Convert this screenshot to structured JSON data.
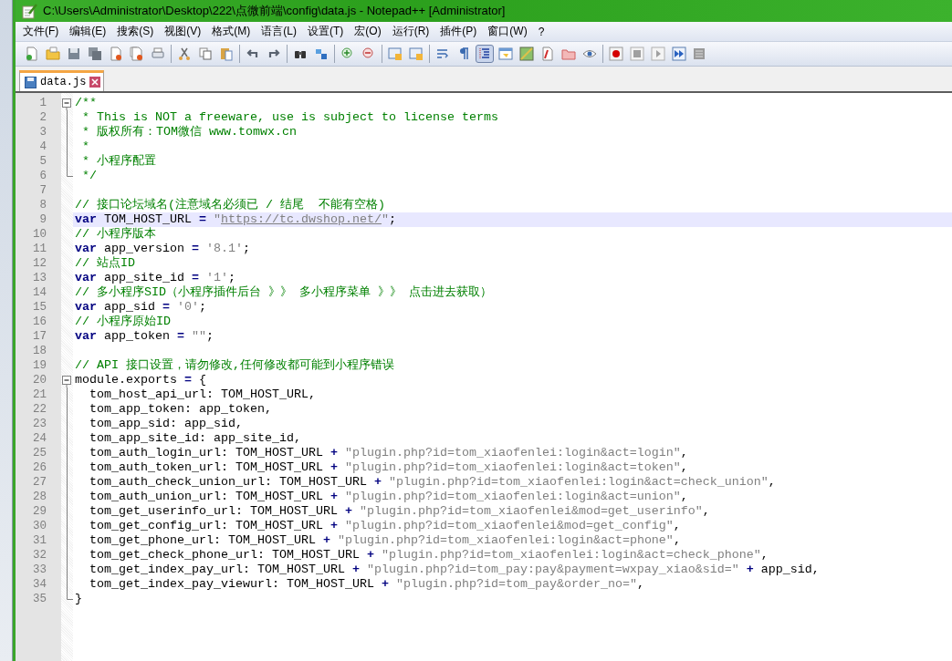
{
  "window": {
    "title": "C:\\Users\\Administrator\\Desktop\\222\\点微前端\\config\\data.js - Notepad++ [Administrator]"
  },
  "menu": [
    "文件(F)",
    "编辑(E)",
    "搜索(S)",
    "视图(V)",
    "格式(M)",
    "语言(L)",
    "设置(T)",
    "宏(O)",
    "运行(R)",
    "插件(P)",
    "窗口(W)",
    "?"
  ],
  "toolbar": [
    [
      {
        "pressed": false
      },
      {
        "pressed": false
      },
      {
        "pressed": false
      },
      {
        "pressed": false
      },
      {
        "pressed": false
      },
      {
        "pressed": false
      },
      {
        "pressed": false
      }
    ],
    [
      {
        "pressed": false
      },
      {
        "pressed": false
      },
      {
        "pressed": false
      }
    ],
    [
      {
        "pressed": false
      },
      {
        "pressed": false
      }
    ],
    [
      {
        "pressed": false
      },
      {
        "pressed": false
      }
    ],
    [
      {
        "pressed": false
      },
      {
        "pressed": false
      }
    ],
    [
      {
        "pressed": false
      },
      {
        "pressed": false
      }
    ],
    [
      {
        "pressed": false
      },
      {
        "pressed": false
      },
      {
        "pressed": true
      },
      {
        "pressed": false
      },
      {
        "pressed": false
      },
      {
        "pressed": false
      },
      {
        "pressed": false
      },
      {
        "pressed": false
      }
    ],
    [
      {
        "pressed": false
      },
      {
        "pressed": false
      },
      {
        "pressed": false
      },
      {
        "pressed": false
      },
      {
        "pressed": false
      }
    ]
  ],
  "tabs": [
    {
      "label": "data.js",
      "selected": true
    }
  ],
  "editor": {
    "lines": [
      {
        "n": "1",
        "kind": "foldstart",
        "selected": false,
        "tokens": [
          {
            "kind": "comment",
            "text": "/**"
          }
        ]
      },
      {
        "n": "2",
        "kind": "foldbody",
        "selected": false,
        "tokens": [
          {
            "kind": "comment",
            "text": " * This is NOT a freeware, use is subject to license terms"
          }
        ]
      },
      {
        "n": "3",
        "kind": "foldbody",
        "selected": false,
        "tokens": [
          {
            "kind": "comment",
            "text": " * 版权所有：TOM微信 www.tomwx.cn"
          }
        ]
      },
      {
        "n": "4",
        "kind": "foldbody",
        "selected": false,
        "tokens": [
          {
            "kind": "comment",
            "text": " *"
          }
        ]
      },
      {
        "n": "5",
        "kind": "foldbody",
        "selected": false,
        "tokens": [
          {
            "kind": "comment",
            "text": " * 小程序配置"
          }
        ]
      },
      {
        "n": "6",
        "kind": "foldend",
        "selected": false,
        "tokens": [
          {
            "kind": "comment",
            "text": " */"
          }
        ]
      },
      {
        "n": "7",
        "kind": "plain",
        "selected": false
      },
      {
        "n": "8",
        "kind": "plain",
        "selected": false,
        "tokens": [
          {
            "kind": "comment",
            "text": "// 接口论坛域名(注意域名必须已 / 结尾  不能有空格)"
          }
        ]
      },
      {
        "n": "9",
        "kind": "plain",
        "selected": true,
        "tokens": [
          {
            "kind": "keyword",
            "text": "var"
          },
          {
            "kind": "text",
            "text": " TOM_HOST_URL "
          },
          {
            "kind": "operator",
            "text": "="
          },
          {
            "kind": "string",
            "text": " \""
          },
          {
            "kind": "url",
            "text": "https://tc.dwshop.net/"
          },
          {
            "kind": "string",
            "text": "\""
          },
          {
            "kind": "text",
            "text": ";"
          }
        ]
      },
      {
        "n": "10",
        "kind": "plain",
        "selected": false,
        "tokens": [
          {
            "kind": "comment",
            "text": "// 小程序版本"
          }
        ]
      },
      {
        "n": "11",
        "kind": "plain",
        "selected": false,
        "tokens": [
          {
            "kind": "keyword",
            "text": "var"
          },
          {
            "kind": "text",
            "text": " app_version "
          },
          {
            "kind": "operator",
            "text": "="
          },
          {
            "kind": "string",
            "text": " '8.1'"
          },
          {
            "kind": "text",
            "text": ";"
          }
        ]
      },
      {
        "n": "12",
        "kind": "plain",
        "selected": false,
        "tokens": [
          {
            "kind": "comment",
            "text": "// 站点ID"
          }
        ]
      },
      {
        "n": "13",
        "kind": "plain",
        "selected": false,
        "tokens": [
          {
            "kind": "keyword",
            "text": "var"
          },
          {
            "kind": "text",
            "text": " app_site_id "
          },
          {
            "kind": "operator",
            "text": "="
          },
          {
            "kind": "string",
            "text": " '1'"
          },
          {
            "kind": "text",
            "text": ";"
          }
        ]
      },
      {
        "n": "14",
        "kind": "plain",
        "selected": false,
        "tokens": [
          {
            "kind": "comment",
            "text": "// 多小程序SID（小程序插件后台 》》 多小程序菜单 》》 点击进去获取）"
          }
        ]
      },
      {
        "n": "15",
        "kind": "plain",
        "selected": false,
        "tokens": [
          {
            "kind": "keyword",
            "text": "var"
          },
          {
            "kind": "text",
            "text": " app_sid "
          },
          {
            "kind": "operator",
            "text": "="
          },
          {
            "kind": "string",
            "text": " '0'"
          },
          {
            "kind": "text",
            "text": ";"
          }
        ]
      },
      {
        "n": "16",
        "kind": "plain",
        "selected": false,
        "tokens": [
          {
            "kind": "comment",
            "text": "// 小程序原始ID"
          }
        ]
      },
      {
        "n": "17",
        "kind": "plain",
        "selected": false,
        "tokens": [
          {
            "kind": "keyword",
            "text": "var"
          },
          {
            "kind": "text",
            "text": " app_token "
          },
          {
            "kind": "operator",
            "text": "="
          },
          {
            "kind": "string",
            "text": " \"\""
          },
          {
            "kind": "text",
            "text": ";"
          }
        ]
      },
      {
        "n": "18",
        "kind": "plain",
        "selected": false
      },
      {
        "n": "19",
        "kind": "plain",
        "selected": false,
        "tokens": [
          {
            "kind": "comment",
            "text": "// API 接口设置，请勿修改,任何修改都可能到小程序错误"
          }
        ]
      },
      {
        "n": "20",
        "kind": "foldstart",
        "selected": false,
        "tokens": [
          {
            "kind": "text",
            "text": "module.exports "
          },
          {
            "kind": "operator",
            "text": "="
          },
          {
            "kind": "text",
            "text": " {"
          }
        ]
      },
      {
        "n": "21",
        "kind": "foldbody",
        "selected": false,
        "tokens": [
          {
            "kind": "text",
            "text": "  tom_host_api_url: TOM_HOST_URL,"
          }
        ]
      },
      {
        "n": "22",
        "kind": "foldbody",
        "selected": false,
        "tokens": [
          {
            "kind": "text",
            "text": "  tom_app_token: app_token,"
          }
        ]
      },
      {
        "n": "23",
        "kind": "foldbody",
        "selected": false,
        "tokens": [
          {
            "kind": "text",
            "text": "  tom_app_sid: app_sid,"
          }
        ]
      },
      {
        "n": "24",
        "kind": "foldbody",
        "selected": false,
        "tokens": [
          {
            "kind": "text",
            "text": "  tom_app_site_id: app_site_id,"
          }
        ]
      },
      {
        "n": "25",
        "kind": "foldbody",
        "selected": false,
        "tokens": [
          {
            "kind": "text",
            "text": "  tom_auth_login_url: TOM_HOST_URL "
          },
          {
            "kind": "operator",
            "text": "+"
          },
          {
            "kind": "string",
            "text": " \"plugin.php?id=tom_xiaofenlei:login&act=login\""
          },
          {
            "kind": "text",
            "text": ","
          }
        ]
      },
      {
        "n": "26",
        "kind": "foldbody",
        "selected": false,
        "tokens": [
          {
            "kind": "text",
            "text": "  tom_auth_token_url: TOM_HOST_URL "
          },
          {
            "kind": "operator",
            "text": "+"
          },
          {
            "kind": "string",
            "text": " \"plugin.php?id=tom_xiaofenlei:login&act=token\""
          },
          {
            "kind": "text",
            "text": ","
          }
        ]
      },
      {
        "n": "27",
        "kind": "foldbody",
        "selected": false,
        "tokens": [
          {
            "kind": "text",
            "text": "  tom_auth_check_union_url: TOM_HOST_URL "
          },
          {
            "kind": "operator",
            "text": "+"
          },
          {
            "kind": "string",
            "text": " \"plugin.php?id=tom_xiaofenlei:login&act=check_union\""
          },
          {
            "kind": "text",
            "text": ","
          }
        ]
      },
      {
        "n": "28",
        "kind": "foldbody",
        "selected": false,
        "tokens": [
          {
            "kind": "text",
            "text": "  tom_auth_union_url: TOM_HOST_URL "
          },
          {
            "kind": "operator",
            "text": "+"
          },
          {
            "kind": "string",
            "text": " \"plugin.php?id=tom_xiaofenlei:login&act=union\""
          },
          {
            "kind": "text",
            "text": ","
          }
        ]
      },
      {
        "n": "29",
        "kind": "foldbody",
        "selected": false,
        "tokens": [
          {
            "kind": "text",
            "text": "  tom_get_userinfo_url: TOM_HOST_URL "
          },
          {
            "kind": "operator",
            "text": "+"
          },
          {
            "kind": "string",
            "text": " \"plugin.php?id=tom_xiaofenlei&mod=get_userinfo\""
          },
          {
            "kind": "text",
            "text": ","
          }
        ]
      },
      {
        "n": "30",
        "kind": "foldbody",
        "selected": false,
        "tokens": [
          {
            "kind": "text",
            "text": "  tom_get_config_url: TOM_HOST_URL "
          },
          {
            "kind": "operator",
            "text": "+"
          },
          {
            "kind": "string",
            "text": " \"plugin.php?id=tom_xiaofenlei&mod=get_config\""
          },
          {
            "kind": "text",
            "text": ","
          }
        ]
      },
      {
        "n": "31",
        "kind": "foldbody",
        "selected": false,
        "tokens": [
          {
            "kind": "text",
            "text": "  tom_get_phone_url: TOM_HOST_URL "
          },
          {
            "kind": "operator",
            "text": "+"
          },
          {
            "kind": "string",
            "text": " \"plugin.php?id=tom_xiaofenlei:login&act=phone\""
          },
          {
            "kind": "text",
            "text": ","
          }
        ]
      },
      {
        "n": "32",
        "kind": "foldbody",
        "selected": false,
        "tokens": [
          {
            "kind": "text",
            "text": "  tom_get_check_phone_url: TOM_HOST_URL "
          },
          {
            "kind": "operator",
            "text": "+"
          },
          {
            "kind": "string",
            "text": " \"plugin.php?id=tom_xiaofenlei:login&act=check_phone\""
          },
          {
            "kind": "text",
            "text": ","
          }
        ]
      },
      {
        "n": "33",
        "kind": "foldbody",
        "selected": false,
        "tokens": [
          {
            "kind": "text",
            "text": "  tom_get_index_pay_url: TOM_HOST_URL "
          },
          {
            "kind": "operator",
            "text": "+"
          },
          {
            "kind": "string",
            "text": " \"plugin.php?id=tom_pay:pay&payment=wxpay_xiao&sid=\""
          },
          {
            "kind": "operator",
            "text": " +"
          },
          {
            "kind": "text",
            "text": " app_sid,"
          }
        ]
      },
      {
        "n": "34",
        "kind": "foldbody",
        "selected": false,
        "tokens": [
          {
            "kind": "text",
            "text": "  tom_get_index_pay_viewurl: TOM_HOST_URL "
          },
          {
            "kind": "operator",
            "text": "+"
          },
          {
            "kind": "string",
            "text": " \"plugin.php?id=tom_pay&order_no=\""
          },
          {
            "kind": "text",
            "text": ","
          }
        ]
      },
      {
        "n": "35",
        "kind": "foldend",
        "selected": false,
        "tokens": [
          {
            "kind": "text",
            "text": "}"
          }
        ]
      }
    ]
  }
}
